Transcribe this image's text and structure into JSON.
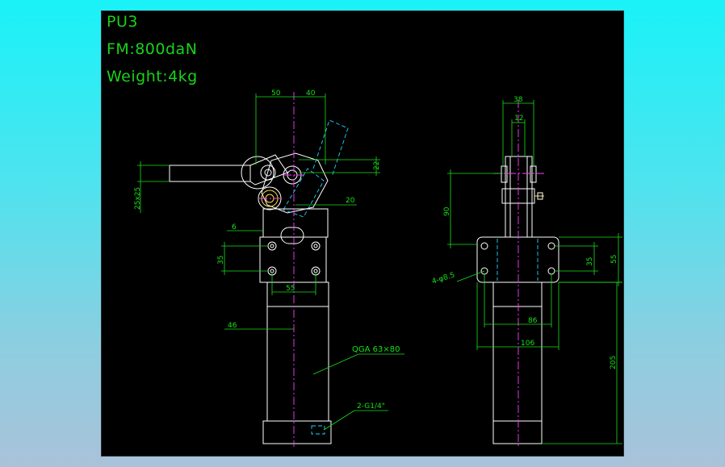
{
  "title_block": {
    "model": "PU3",
    "force": "FM:800daN",
    "weight": "Weight:4kg"
  },
  "side_view": {
    "dims": {
      "d50": "50",
      "d40": "40",
      "d22": "22",
      "d20": "20",
      "handle": "25x25",
      "d6": "6",
      "d35": "35",
      "d55": "55",
      "d46": "46"
    },
    "callouts": {
      "cylinder": "QGA 63×80",
      "port": "2-G1/4\""
    }
  },
  "front_view": {
    "dims": {
      "d38": "38",
      "d12": "12",
      "d90": "90",
      "holes": "4-φ8.5",
      "d35": "35",
      "d55": "55",
      "d86": "86",
      "d106": "106",
      "d205": "205"
    }
  },
  "colors": {
    "background": "#000000",
    "outline": "#ffffff",
    "dimension": "#19e019",
    "centerline": "#ff3cff",
    "phantom": "#1fd6ff"
  }
}
